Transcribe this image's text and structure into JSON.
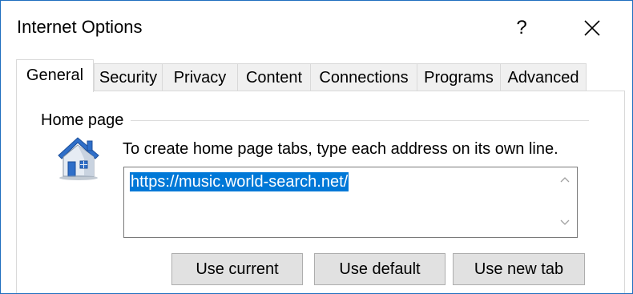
{
  "window": {
    "title": "Internet Options",
    "help_label": "?"
  },
  "tabs": [
    {
      "label": "General",
      "active": true
    },
    {
      "label": "Security",
      "active": false
    },
    {
      "label": "Privacy",
      "active": false
    },
    {
      "label": "Content",
      "active": false
    },
    {
      "label": "Connections",
      "active": false
    },
    {
      "label": "Programs",
      "active": false
    },
    {
      "label": "Advanced",
      "active": false
    }
  ],
  "home_page": {
    "group_label": "Home page",
    "instruction": "To create home page tabs, type each address on its own line.",
    "url_value": "https://music.world-search.net/",
    "icon": "house-icon"
  },
  "buttons": {
    "use_current": "Use current",
    "use_default": "Use default",
    "use_new_tab": "Use new tab"
  },
  "colors": {
    "accent": "#0078d7",
    "window_border": "#1f6fbf",
    "button_bg": "#e1e1e1"
  }
}
